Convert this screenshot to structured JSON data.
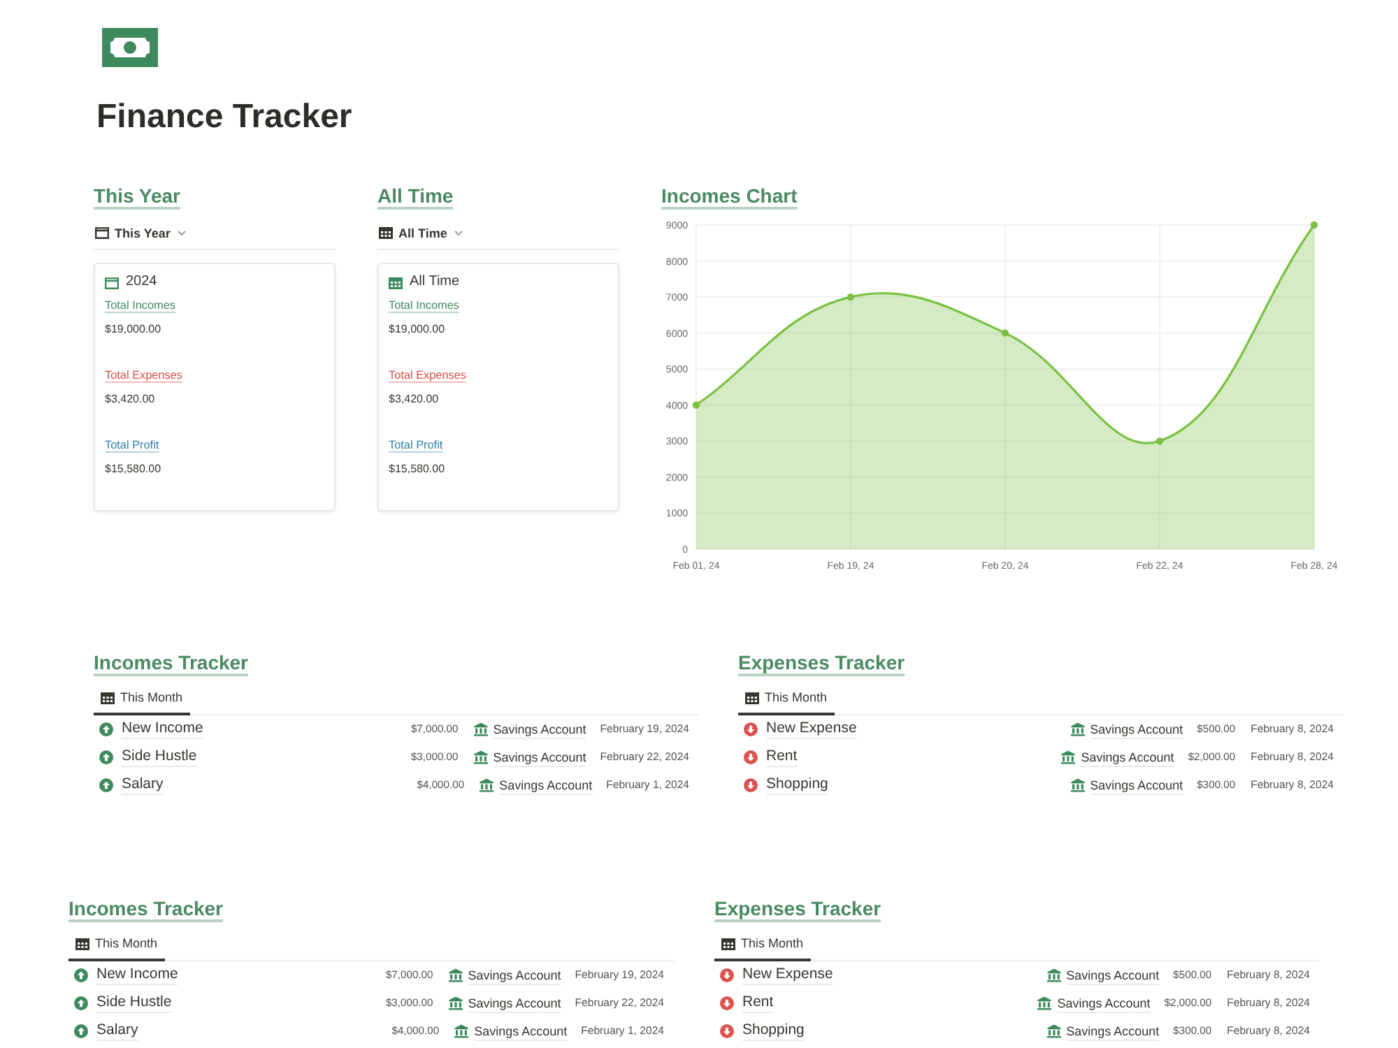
{
  "page": {
    "title": "Finance Tracker"
  },
  "summaries": [
    {
      "kind": "year",
      "heading": "This Year",
      "view": "This Year",
      "card": {
        "title": "2024",
        "metrics": [
          {
            "kind": "income",
            "label": "Total Incomes",
            "value": "$19,000.00"
          },
          {
            "kind": "expense",
            "label": "Total Expenses",
            "value": "$3,420.00"
          },
          {
            "kind": "profit",
            "label": "Total Profit",
            "value": "$15,580.00"
          }
        ]
      }
    },
    {
      "kind": "all_time",
      "heading": "All Time",
      "view": "All Time",
      "card": {
        "title": "All Time",
        "metrics": [
          {
            "kind": "income",
            "label": "Total Incomes",
            "value": "$19,000.00"
          },
          {
            "kind": "expense",
            "label": "Total Expenses",
            "value": "$3,420.00"
          },
          {
            "kind": "profit",
            "label": "Total Profit",
            "value": "$15,580.00"
          }
        ]
      }
    }
  ],
  "incomes_chart": {
    "heading": "Incomes Chart",
    "chart_data": {
      "type": "area",
      "categories": [
        "Feb 01, 24",
        "Feb 19, 24",
        "Feb 20, 24",
        "Feb 22, 24",
        "Feb 28, 24"
      ],
      "series": [
        {
          "color": "#7ac143",
          "values": [
            4000,
            7000,
            6000,
            3000,
            9000
          ]
        }
      ],
      "ylim": [
        0,
        9000
      ],
      "yticks": [
        0,
        1000,
        2000,
        3000,
        4000,
        5000,
        6000,
        7000,
        8000,
        9000
      ],
      "grid": true
    }
  },
  "tracker_sections": [
    {
      "trackers": [
        {
          "kind": "income",
          "heading": "Incomes Tracker",
          "tabs": [
            {
              "label": "This Month",
              "selected": true
            }
          ],
          "rows": [
            {
              "name": "New Income",
              "amount": "$7,000.00",
              "account": "Savings Account",
              "date": "February 19, 2024"
            },
            {
              "name": "Side Hustle",
              "amount": "$3,000.00",
              "account": "Savings Account",
              "date": "February 22, 2024"
            },
            {
              "name": "Salary",
              "amount": "$4,000.00",
              "account": "Savings Account",
              "date": "February 1, 2024"
            }
          ]
        },
        {
          "kind": "expense",
          "heading": "Expenses Tracker",
          "tabs": [
            {
              "label": "This Month",
              "selected": true
            }
          ],
          "rows": [
            {
              "name": "New Expense",
              "amount": "$500.00",
              "account": "Savings Account",
              "date": "February 8, 2024"
            },
            {
              "name": "Rent",
              "amount": "$2,000.00",
              "account": "Savings Account",
              "date": "February 8, 2024"
            },
            {
              "name": "Shopping",
              "amount": "$300.00",
              "account": "Savings Account",
              "date": "February 8, 2024"
            }
          ]
        }
      ]
    },
    {
      "trackers": [
        {
          "kind": "income",
          "heading": "Incomes Tracker",
          "tabs": [
            {
              "label": "This Month",
              "selected": true
            }
          ],
          "rows": [
            {
              "name": "New Income",
              "amount": "$7,000.00",
              "account": "Savings Account",
              "date": "February 19, 2024"
            },
            {
              "name": "Side Hustle",
              "amount": "$3,000.00",
              "account": "Savings Account",
              "date": "February 22, 2024"
            },
            {
              "name": "Salary",
              "amount": "$4,000.00",
              "account": "Savings Account",
              "date": "February 1, 2024"
            }
          ]
        },
        {
          "kind": "expense",
          "heading": "Expenses Tracker",
          "tabs": [
            {
              "label": "This Month",
              "selected": true
            }
          ],
          "rows": [
            {
              "name": "New Expense",
              "amount": "$500.00",
              "account": "Savings Account",
              "date": "February 8, 2024"
            },
            {
              "name": "Rent",
              "amount": "$2,000.00",
              "account": "Savings Account",
              "date": "February 8, 2024"
            },
            {
              "name": "Shopping",
              "amount": "$300.00",
              "account": "Savings Account",
              "date": "February 8, 2024"
            }
          ]
        }
      ]
    }
  ]
}
